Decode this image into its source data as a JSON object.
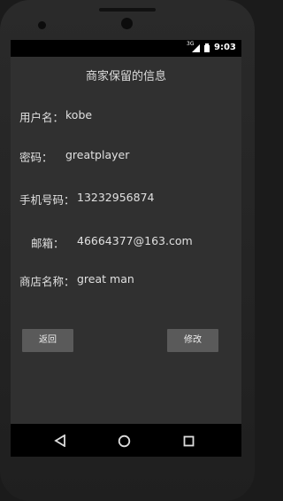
{
  "status_bar": {
    "time": "9:03",
    "network": "3G"
  },
  "app": {
    "title": "商家保留的信息",
    "fields": [
      {
        "label": "用户名：",
        "value": "kobe"
      },
      {
        "label": "密码：",
        "value": "greatplayer"
      },
      {
        "label": "手机号码：",
        "value": "13232956874"
      },
      {
        "label": "邮箱：",
        "value": "46664377@163.com"
      },
      {
        "label": "商店名称：",
        "value": "great man"
      }
    ],
    "back_button": "返回",
    "edit_button": "修改"
  },
  "nav": {
    "back_icon": "back-triangle-icon",
    "home_icon": "home-circle-icon",
    "recents_icon": "recents-square-icon"
  }
}
